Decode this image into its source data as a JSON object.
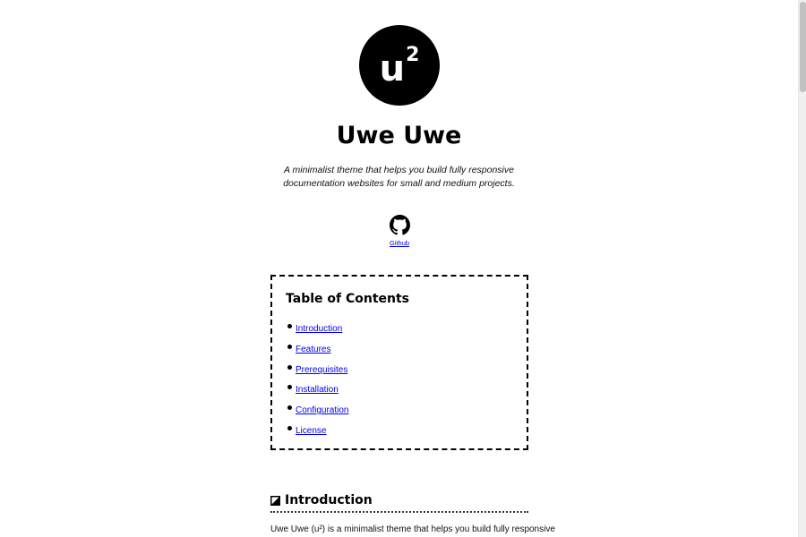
{
  "logo": {
    "text": "u",
    "superscript": "2"
  },
  "site_title": "Uwe Uwe",
  "tagline": "A minimalist theme that helps you build fully responsive documentation websites for small and medium projects.",
  "github": {
    "icon": "github-icon",
    "label": "Github"
  },
  "toc": {
    "title": "Table of Contents",
    "items": [
      {
        "label": "Introduction"
      },
      {
        "label": "Features"
      },
      {
        "label": "Prerequisites"
      },
      {
        "label": "Installation"
      },
      {
        "label": "Configuration"
      },
      {
        "label": "License"
      }
    ]
  },
  "intro": {
    "icon": "section-icon",
    "title": "Introduction",
    "text": "Uwe Uwe (u²) is a minimalist theme that helps you build fully responsive"
  },
  "colors": {
    "link": "#0000ee",
    "text": "#111111",
    "logo_bg": "#000000"
  }
}
